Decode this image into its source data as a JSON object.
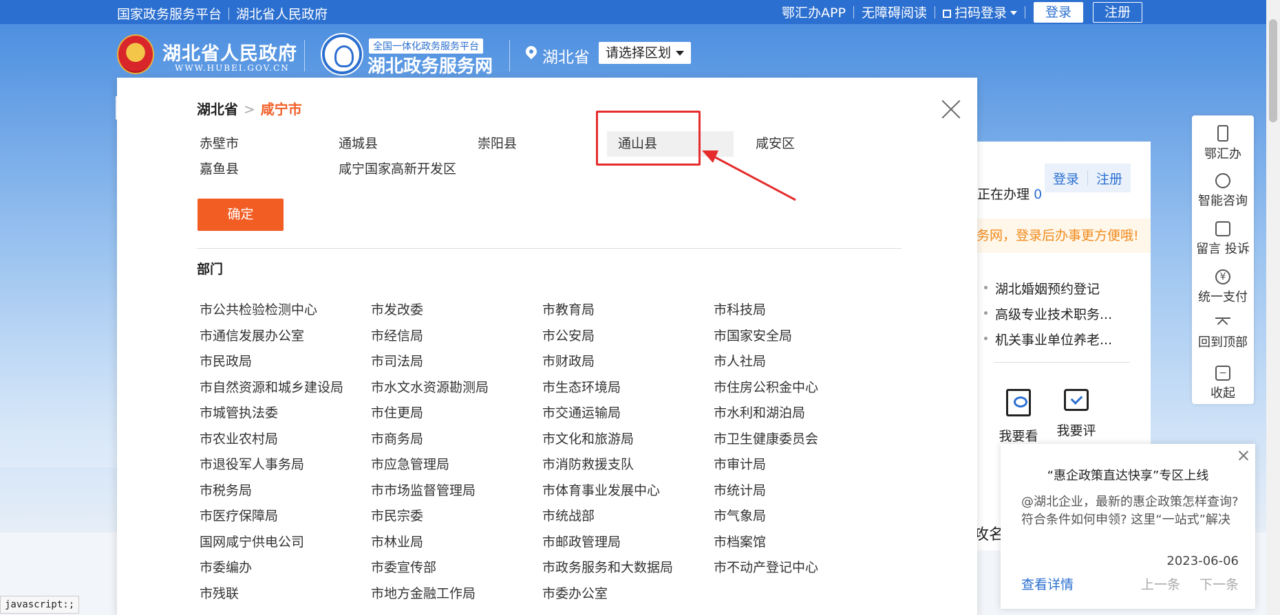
{
  "topbar": {
    "platform": "国家政务服务平台",
    "gov": "湖北省人民政府",
    "app": "鄂汇办APP",
    "accessible": "无障碍阅读",
    "scan_login": "扫码登录",
    "login": "登录",
    "register": "注册"
  },
  "header": {
    "gov_name": "湖北省人民政府",
    "gov_url": "WWW.HUBEI.GOV.CN",
    "svc_tag": "全国一体化政务服务平台",
    "svc_name": "湖北政务服务网",
    "province": "湖北省",
    "region_select": "请选择区划"
  },
  "modal": {
    "crumb_province": "湖北省",
    "crumb_sep": ">",
    "crumb_city": "咸宁市",
    "districts": [
      "赤壁市",
      "通城县",
      "崇阳县",
      "通山县",
      "咸安区",
      "嘉鱼县",
      "咸宁国家高新开发区"
    ],
    "selected_district": "通山县",
    "confirm": "确定",
    "dept_title": "部门",
    "departments": [
      "市公共检验检测中心",
      "市发改委",
      "市教育局",
      "市科技局",
      "市通信发展办公室",
      "市经信局",
      "市公安局",
      "市国家安全局",
      "市民政局",
      "市司法局",
      "市财政局",
      "市人社局",
      "市自然资源和城乡建设局",
      "市水文水资源勘测局",
      "市生态环境局",
      "市住房公积金中心",
      "市城管执法委",
      "市住更局",
      "市交通运输局",
      "市水利和湖泊局",
      "市农业农村局",
      "市商务局",
      "市文化和旅游局",
      "市卫生健康委员会",
      "市退役军人事务局",
      "市应急管理局",
      "市消防救援支队",
      "市审计局",
      "市税务局",
      "市市场监督管理局",
      "市体育事业发展中心",
      "市统计局",
      "市医疗保障局",
      "市民宗委",
      "市统战部",
      "市气象局",
      "国网咸宁供电公司",
      "市林业局",
      "市邮政管理局",
      "市档案馆",
      "市委编办",
      "市委宣传部",
      "市政务服务和大数据局",
      "市不动产登记中心",
      "市残联",
      "市地方金融工作局",
      "市委办公室"
    ]
  },
  "user_panel": {
    "status_label": "正在办理",
    "status_count": "0",
    "login": "登录",
    "register": "注册",
    "hint": "务网，登录后办事更方便哦!",
    "items": [
      "湖北婚姻预约登记",
      "高级专业技术职务...",
      "机关事业单位养老..."
    ],
    "action_look": "我要看",
    "action_rate": "我要评",
    "fragment": "攻名!"
  },
  "float_bar": {
    "items": [
      {
        "icon": "phone-icon",
        "label": "鄂汇办"
      },
      {
        "icon": "robot-icon",
        "label": "智能咨询"
      },
      {
        "icon": "message-icon",
        "label": "留言 投诉"
      },
      {
        "icon": "yuan-icon",
        "label": "统一支付"
      },
      {
        "icon": "arrow-up-icon",
        "label": "回到顶部"
      },
      {
        "icon": "collapse-icon",
        "label": "收起"
      }
    ]
  },
  "notice": {
    "title": "“惠企政策直达快享”专区上线",
    "body": "@湖北企业，最新的惠企政策怎样查询? 符合条件如何申领? 这里“一站式”解决",
    "date": "2023-06-06",
    "detail": "查看详情",
    "prev": "上一条",
    "next": "下一条"
  },
  "statusbar": "javascript:;",
  "colors": {
    "brand_blue": "#2b6fd0",
    "accent_orange": "#f25d23",
    "annotation_red": "#e52b2b"
  }
}
